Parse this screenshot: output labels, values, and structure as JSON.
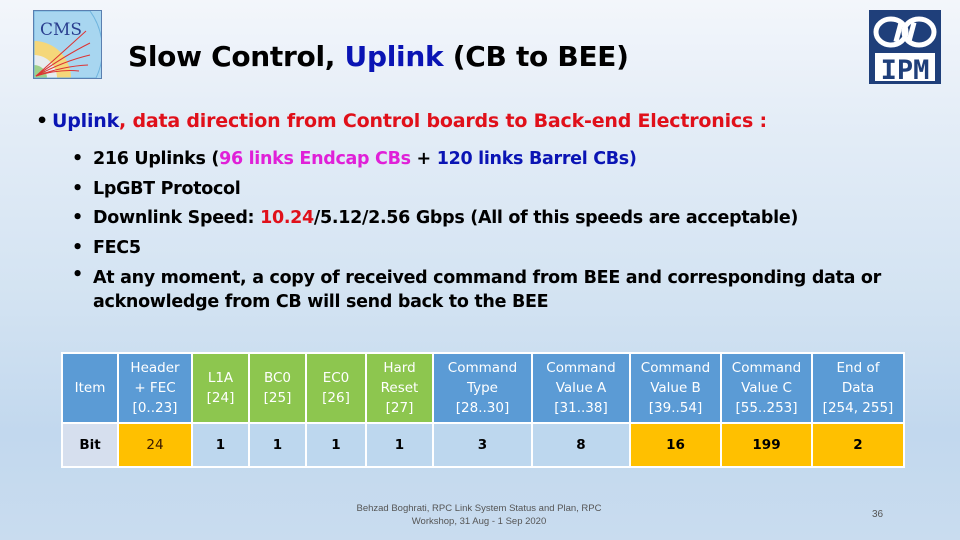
{
  "logos": {
    "left": {
      "icon": "cms-logo",
      "text": "CMS"
    },
    "right": {
      "icon": "ipm-logo",
      "text": "IPM"
    }
  },
  "title": {
    "part1": "Slow Control, ",
    "part2": "Uplink",
    "part3": " (CB to BEE)",
    "accent_color": "#0a14b4"
  },
  "main_bullet": {
    "part1": "Uplink",
    "part2": ", data direction from Control boards to Back-end Electronics :"
  },
  "sub_bullets": [
    {
      "a": "216 Uplinks (",
      "b": "96 links Endcap CBs",
      "c": " + ",
      "d": "120 links Barrel CBs)"
    },
    {
      "text": "LpGBT Protocol"
    },
    {
      "a": "Downlink Speed: ",
      "b": "10.24",
      "c": "/5.12/2.56 Gbps  (All of this speeds are acceptable)"
    },
    {
      "text": "FEC5"
    },
    {
      "text": "At any moment, a copy of received command from BEE and corresponding data or acknowledge from CB will send back to the BEE"
    }
  ],
  "table": {
    "header_row": [
      {
        "lines": [
          "Item"
        ]
      },
      {
        "lines": [
          "Header",
          "+ FEC",
          "[0..23]"
        ]
      },
      {
        "lines": [
          "L1A",
          "[24]"
        ]
      },
      {
        "lines": [
          "BC0",
          "[25]"
        ]
      },
      {
        "lines": [
          "EC0",
          "[26]"
        ]
      },
      {
        "lines": [
          "Hard",
          "Reset",
          "[27]"
        ]
      },
      {
        "lines": [
          "Command",
          "Type",
          "[28..30]"
        ]
      },
      {
        "lines": [
          "Command",
          "Value A",
          "[31..38]"
        ]
      },
      {
        "lines": [
          "Command",
          "Value B",
          "[39..54]"
        ]
      },
      {
        "lines": [
          "Command",
          "Value C",
          "[55..253]"
        ]
      },
      {
        "lines": [
          "End of",
          "Data",
          "[254, 255]"
        ]
      }
    ],
    "value_row": [
      "Bit",
      "24",
      "1",
      "1",
      "1",
      "1",
      "3",
      "8",
      "16",
      "199",
      "2"
    ],
    "colors": {
      "header_blue": "#5b9bd5",
      "header_green": "#8dc64f",
      "value_light": "#bdd7ee",
      "value_amber": "#ffc000",
      "label_grey": "#d6dfee"
    }
  },
  "footer": {
    "line1": "Behzad Boghrati, RPC Link System Status and Plan, RPC",
    "line2": "Workshop, 31 Aug - 1 Sep  2020",
    "page_number": "36"
  }
}
